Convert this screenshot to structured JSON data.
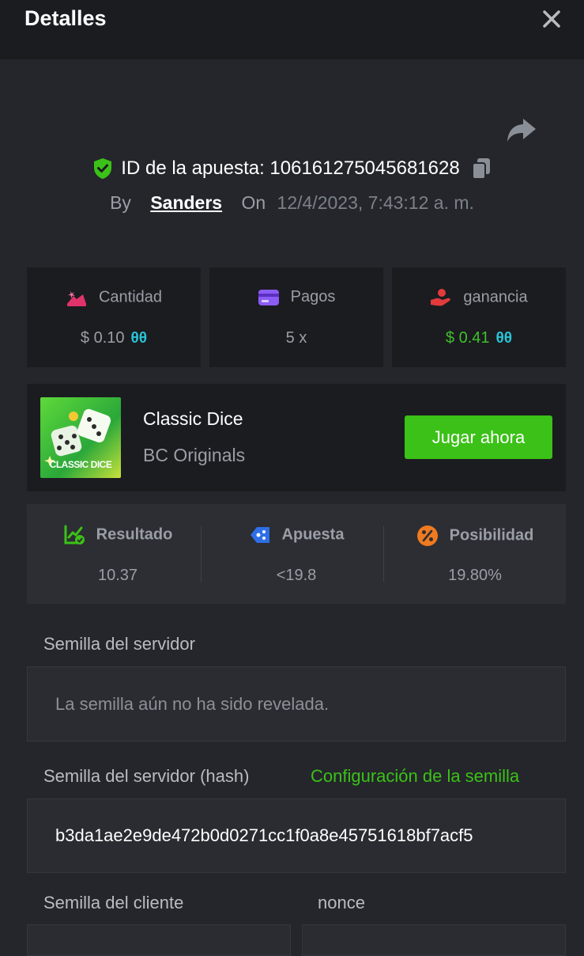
{
  "header": {
    "title": "Detalles"
  },
  "bet": {
    "id_label": "ID de la apuesta: 106161275045681628",
    "by_label": "By",
    "user": "Sanders",
    "on_label": "On",
    "date": "12/4/2023, 7:43:12 a. m."
  },
  "stats": [
    {
      "label": "Cantidad",
      "value": "$ 0.10",
      "coin": "θθ",
      "icon": "bet-amount-icon"
    },
    {
      "label": "Pagos",
      "value": "5 x",
      "icon": "payout-card-icon"
    },
    {
      "label": "ganancia",
      "value": "$ 0.41",
      "coin": "θθ",
      "icon": "profit-hand-icon"
    }
  ],
  "game": {
    "thumb_label": "CLASSIC DICE",
    "name": "Classic Dice",
    "provider": "BC Originals",
    "play_label": "Jugar ahora"
  },
  "results": [
    {
      "label": "Resultado",
      "value": "10.37",
      "icon": "result-chart-icon"
    },
    {
      "label": "Apuesta",
      "value": "<19.8",
      "icon": "bet-tag-icon"
    },
    {
      "label": "Posibilidad",
      "value": "19.80%",
      "icon": "percent-icon"
    }
  ],
  "seeds": {
    "server_label": "Semilla del servidor",
    "server_value": "La semilla aún no ha sido revelada.",
    "hash_label": "Semilla del servidor (hash)",
    "config_link": "Configuración de la semilla",
    "hash_value": "b3da1ae2e9de472b0d0271cc1f0a8e45751618bf7acf5",
    "client_label": "Semilla del cliente",
    "nonce_label": "nonce"
  },
  "colors": {
    "accent": "#3bc117",
    "background": "#24262b",
    "panel": "#1b1c20"
  }
}
